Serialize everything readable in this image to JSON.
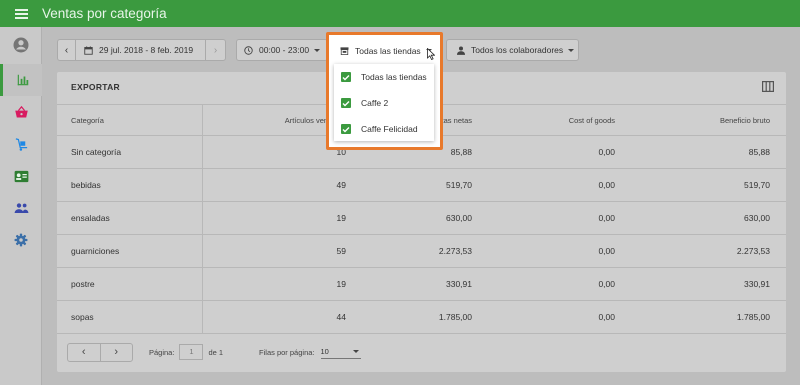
{
  "app": {
    "title": "Ventas por categoría"
  },
  "colors": {
    "brand": "#3b9a3f",
    "highlight": "#e8792b",
    "checkbox": "#3b9a3f"
  },
  "sidebar": {
    "items": [
      {
        "icon": "account-circle-icon",
        "active": false
      },
      {
        "icon": "bar-chart-icon",
        "active": true
      },
      {
        "icon": "basket-icon",
        "active": false
      },
      {
        "icon": "dolly-icon",
        "active": false
      },
      {
        "icon": "id-card-icon",
        "active": false
      },
      {
        "icon": "people-icon",
        "active": false
      },
      {
        "icon": "gear-icon",
        "active": false
      }
    ]
  },
  "filters": {
    "date_range": "29 jul. 2018 - 8 feb. 2019",
    "time_range": "00:00 - 23:00",
    "stores": "Todas las tiendas",
    "collaborators": "Todos los colaboradores"
  },
  "stores_dropdown": {
    "options": [
      {
        "label": "Todas las tiendas",
        "checked": true
      },
      {
        "label": "Caffe 2",
        "checked": true
      },
      {
        "label": "Caffe Felicidad",
        "checked": true
      }
    ]
  },
  "report": {
    "export_label": "EXPORTAR",
    "columns": [
      "Categoría",
      "Artículos vendidos",
      "Ventas netas",
      "Cost of goods",
      "Beneficio bruto"
    ],
    "rows": [
      [
        "Sin categoría",
        "10",
        "85,88",
        "0,00",
        "85,88"
      ],
      [
        "bebidas",
        "49",
        "519,70",
        "0,00",
        "519,70"
      ],
      [
        "ensaladas",
        "19",
        "630,00",
        "0,00",
        "630,00"
      ],
      [
        "guarniciones",
        "59",
        "2.273,53",
        "0,00",
        "2.273,53"
      ],
      [
        "postre",
        "19",
        "330,91",
        "0,00",
        "330,91"
      ],
      [
        "sopas",
        "44",
        "1.785,00",
        "0,00",
        "1.785,00"
      ]
    ]
  },
  "pagination": {
    "page_label": "Página:",
    "page_value": "1",
    "of_label": "de 1",
    "rows_per_page_label": "Filas por página:",
    "rows_per_page_value": "10"
  }
}
